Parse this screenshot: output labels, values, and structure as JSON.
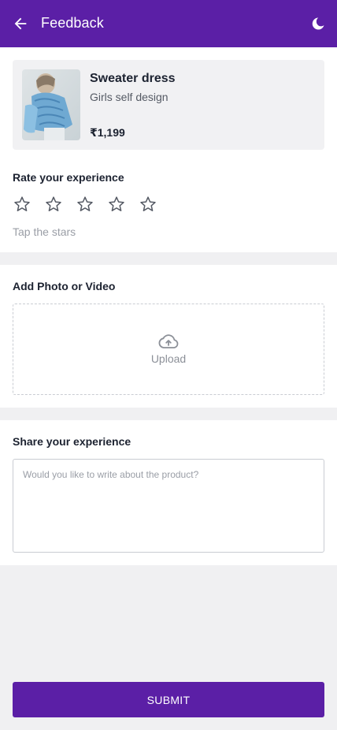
{
  "app_bar": {
    "title": "Feedback",
    "back_icon": "arrow-left-icon",
    "theme_icon": "moon-icon",
    "background": "#5b1fa6"
  },
  "product": {
    "name": "Sweater dress",
    "description": "Girls self design",
    "price": "₹1,199"
  },
  "rating": {
    "label": "Rate your experience",
    "stars": 5,
    "value": 0,
    "hint": "Tap the stars"
  },
  "upload": {
    "label": "Add Photo or Video",
    "button_text": "Upload",
    "icon": "cloud-upload-icon"
  },
  "share": {
    "label": "Share your experience",
    "placeholder": "Would you like to write about the product?",
    "value": ""
  },
  "submit": {
    "label": "SUBMIT"
  }
}
